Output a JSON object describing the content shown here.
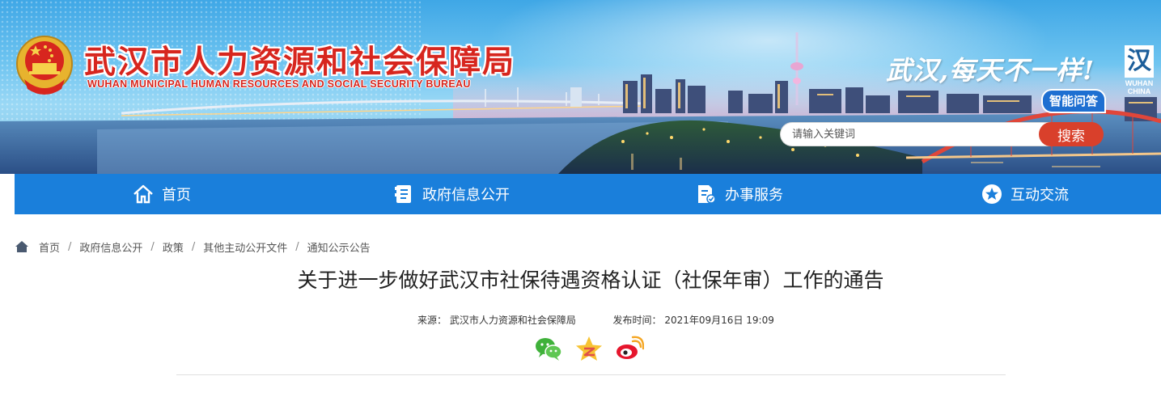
{
  "header": {
    "title_cn": "武汉市人力资源和社会保障局",
    "title_en": "WUHAN MUNICIPAL HUMAN RESOURCES AND SOCIAL SECURITY BUREAU",
    "slogan": "武汉,每天不一样!",
    "city_logo_en": "WUHAN CHINA",
    "smart_qa": "智能问答",
    "search": {
      "placeholder": "请输入关键词",
      "button": "搜索"
    },
    "icons": [
      "national-emblem-icon",
      "wuhan-logo-icon"
    ]
  },
  "nav": {
    "items": [
      {
        "label": "首页",
        "icon": "home-icon"
      },
      {
        "label": "政府信息公开",
        "icon": "document-icon"
      },
      {
        "label": "办事服务",
        "icon": "service-icon"
      },
      {
        "label": "互动交流",
        "icon": "star-icon"
      }
    ]
  },
  "breadcrumb": {
    "items": [
      "首页",
      "政府信息公开",
      "政策",
      "其他主动公开文件",
      "通知公示公告"
    ],
    "separator": "/"
  },
  "article": {
    "title": "关于进一步做好武汉市社保待遇资格认证（社保年审）工作的通告",
    "source_label": "来源：",
    "source": "武汉市人力资源和社会保障局",
    "time_label": "发布时间：",
    "time": "2021年09月16日 19:09",
    "share": [
      "wechat-icon",
      "qzone-icon",
      "weibo-icon"
    ]
  },
  "colors": {
    "nav_bg": "#1a7fdb",
    "title_red": "#d7261e",
    "search_btn": "#d9402b",
    "qa_bg": "#1e6fd1"
  }
}
